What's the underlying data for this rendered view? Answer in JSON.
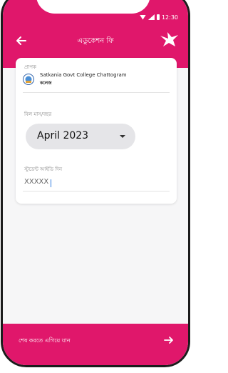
{
  "status_bar": {
    "time": "12:30"
  },
  "header": {
    "title": "এডুকেশন ফি"
  },
  "institution": {
    "label": "প্রাপক",
    "name": "Satkania Govt College Chattogram",
    "subtitle": "কলেজ"
  },
  "month": {
    "label": "বিল মাস/বছর",
    "selected": "April 2023"
  },
  "student_id": {
    "label": "স্টুডেন্ট আইডি দিন",
    "value": "XXXXX"
  },
  "footer": {
    "next_label": "শেষ করতে এগিয়ে যান"
  },
  "colors": {
    "accent": "#e0176b"
  }
}
